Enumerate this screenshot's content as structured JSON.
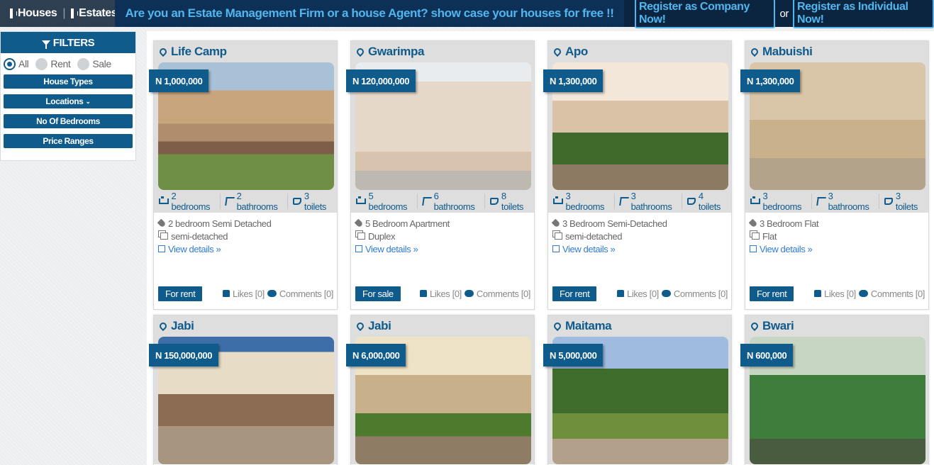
{
  "topbar": {
    "houses": "Houses",
    "estates": "Estates",
    "chevron": "»",
    "promo": "Are you an Estate Management Firm or a house Agent? show case your houses for free !!",
    "register_company": "Register as Company Now!",
    "or": "or",
    "register_individual": "Register as Individual Now!"
  },
  "filters": {
    "title": "FILTERS",
    "radios": [
      "All",
      "Rent",
      "Sale"
    ],
    "selected": "All",
    "house_types": "House Types",
    "locations": "Locations",
    "bedrooms": "No Of Bedrooms",
    "price_ranges": "Price Ranges"
  },
  "labels": {
    "view_details": "View details »",
    "likes": "Likes [0]",
    "comments": "Comments [0]"
  },
  "listings": [
    {
      "location": "Life Camp",
      "price": "N 1,000,000",
      "bedrooms": "2 bedrooms",
      "bathrooms": "2 bathrooms",
      "toilets": "3 toilets",
      "title": "2 bedroom Semi Detached",
      "type": "semi-detached",
      "status": "For rent"
    },
    {
      "location": "Gwarimpa",
      "price": "N 120,000,000",
      "bedrooms": "5 bedrooms",
      "bathrooms": "6 bathrooms",
      "toilets": "8 toilets",
      "title": "5 Bedroom Apartment",
      "type": "Duplex",
      "status": "For sale"
    },
    {
      "location": "Apo",
      "price": "N 1,300,000",
      "bedrooms": "3 bedrooms",
      "bathrooms": "3 bathrooms",
      "toilets": "4 toilets",
      "title": "3 Bedroom Semi-Detached",
      "type": "semi-detached",
      "status": "For rent"
    },
    {
      "location": "Mabuishi",
      "price": "N 1,300,000",
      "bedrooms": "3 bedrooms",
      "bathrooms": "3 bathrooms",
      "toilets": "3 toilets",
      "title": "3 Bedroom Flat",
      "type": "Flat",
      "status": "For rent"
    },
    {
      "location": "Jabi",
      "price": "N 150,000,000"
    },
    {
      "location": "Jabi",
      "price": "N 6,000,000"
    },
    {
      "location": "Maitama",
      "price": "N 5,000,000"
    },
    {
      "location": "Bwari",
      "price": "N 600,000"
    }
  ],
  "icons": {
    "houses": "building-icon",
    "estates": "building-icon",
    "filter": "filter-icon",
    "location": "map-pin-icon",
    "bed": "bed-icon",
    "bath": "bath-icon",
    "toilet": "toilet-icon",
    "tag": "tag-icon",
    "type": "clone-icon",
    "external": "external-link-icon",
    "like": "thumbs-up-icon",
    "comment": "comments-icon"
  },
  "colors": {
    "primary": "#0f5b8c",
    "topbar": "#0b2440",
    "accent": "#52b6ee",
    "link": "#2f7bd9"
  }
}
